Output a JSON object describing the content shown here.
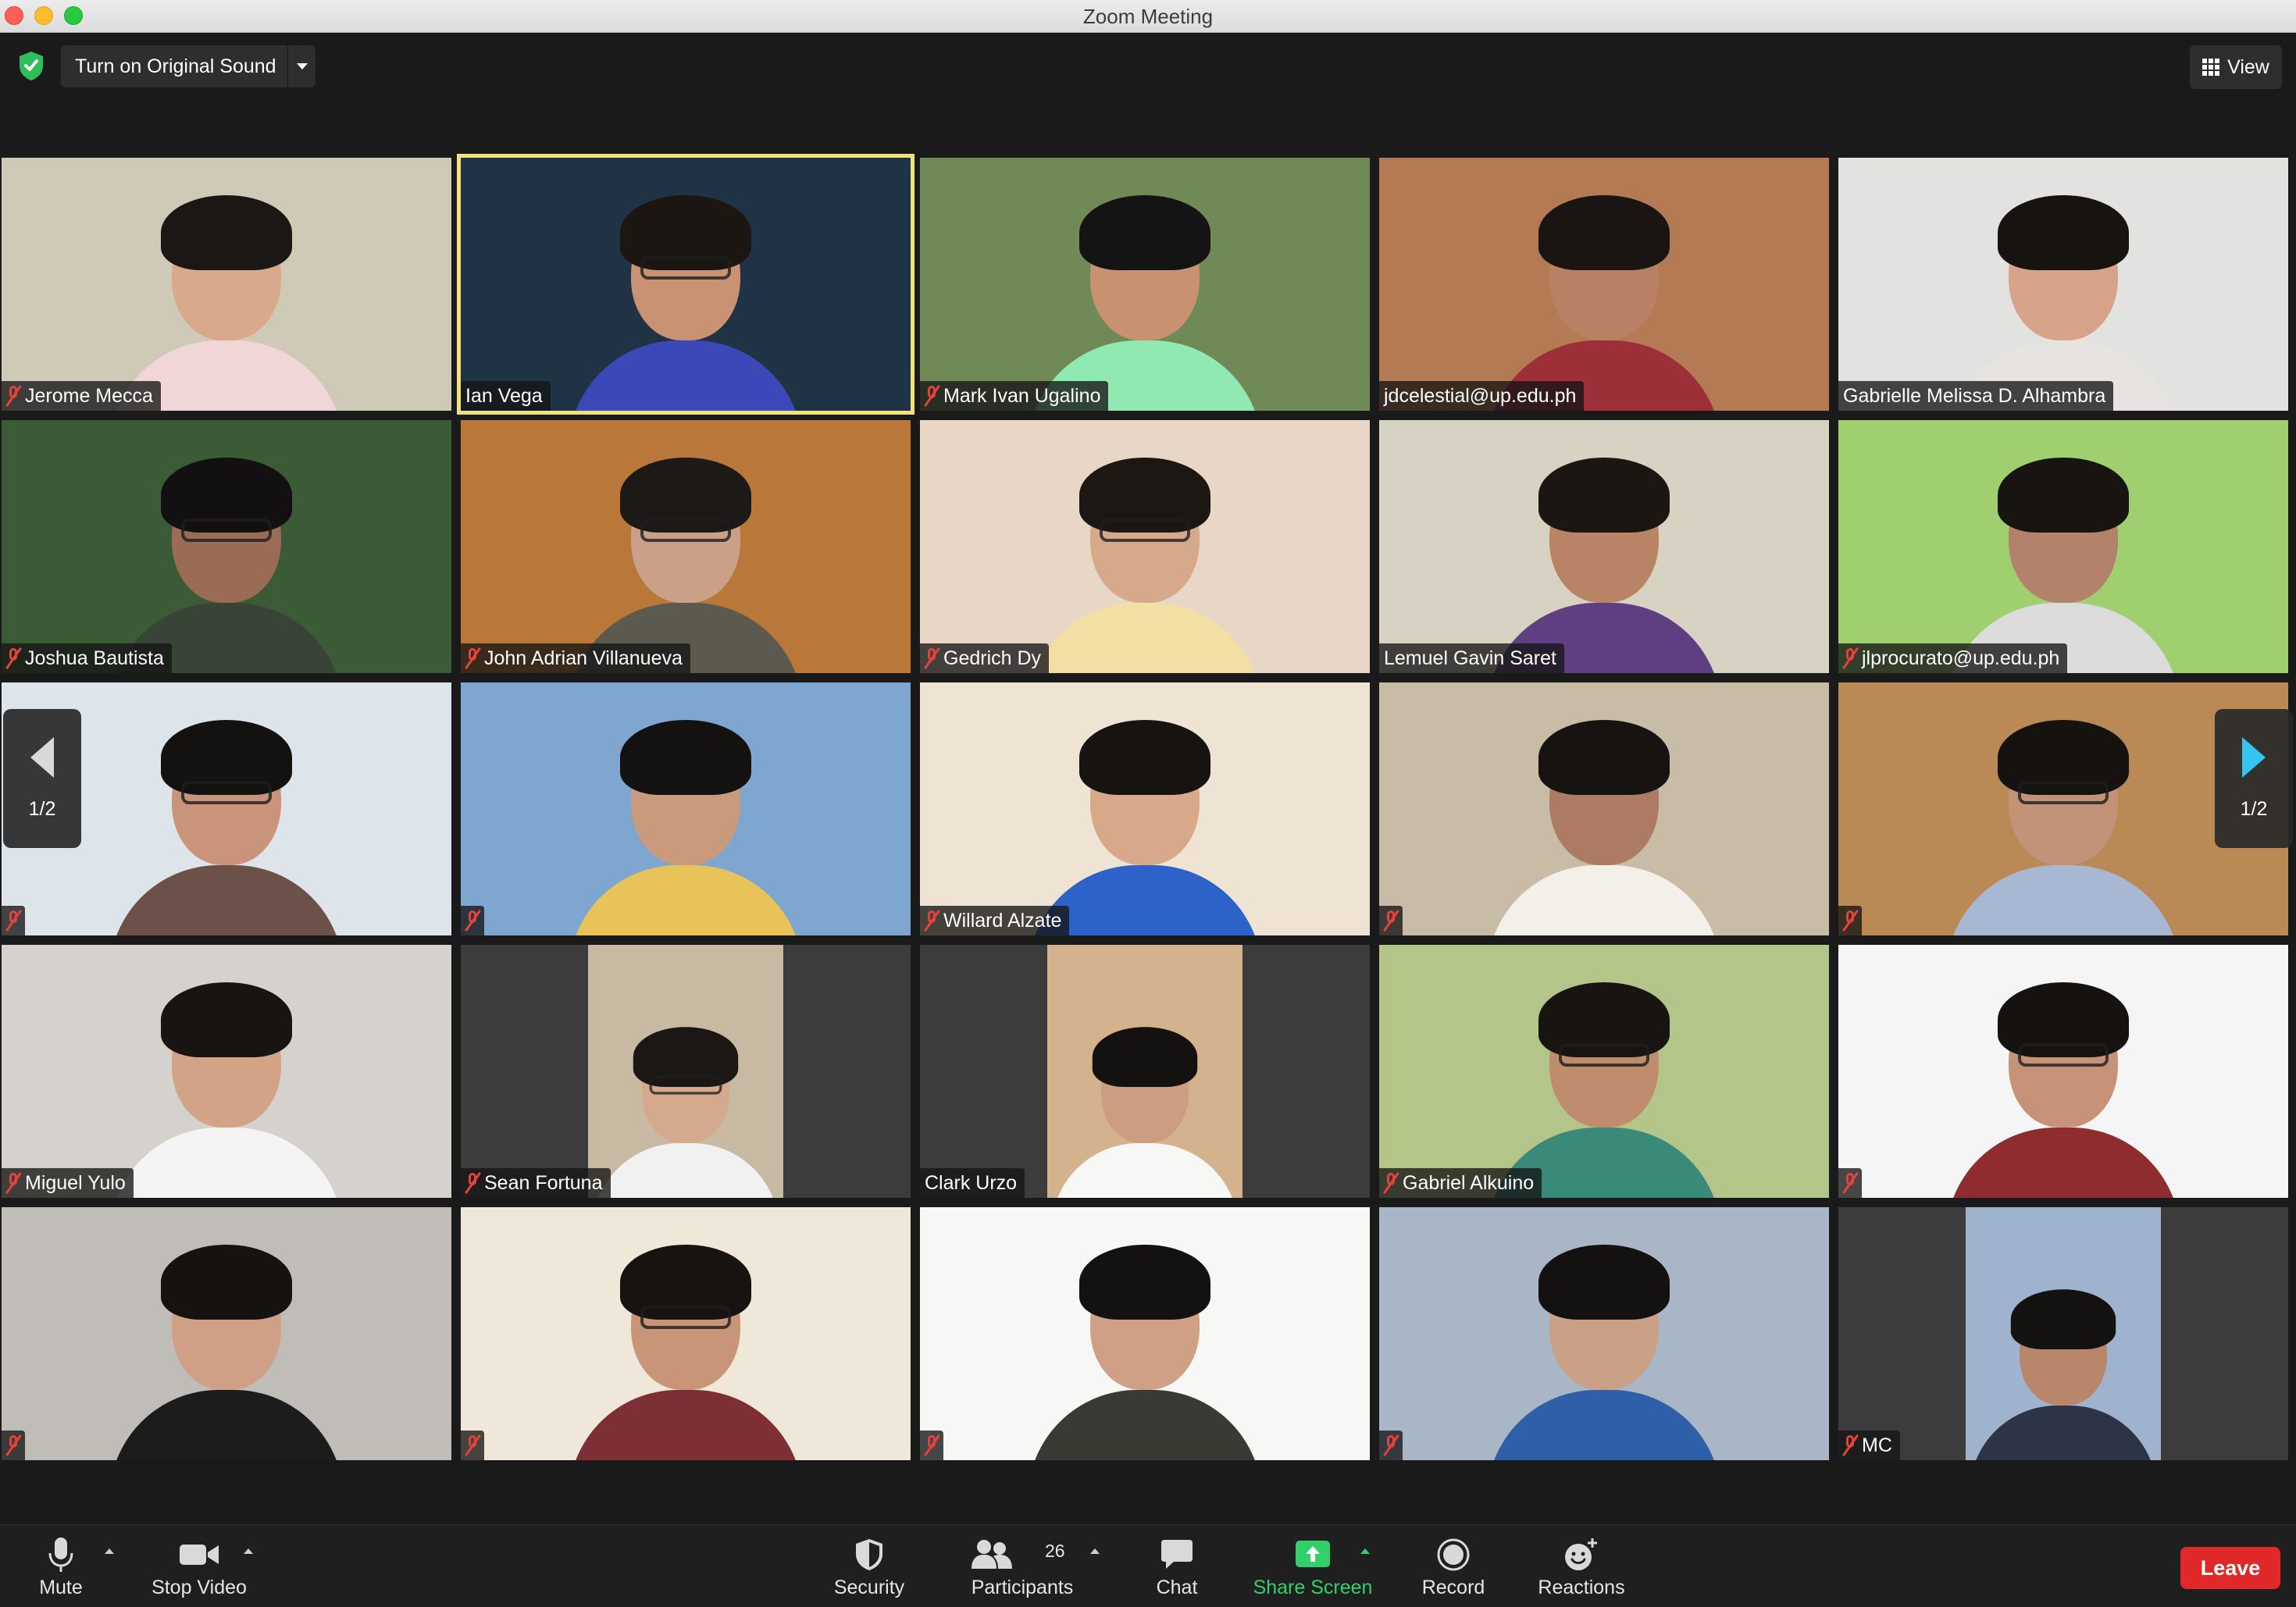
{
  "window": {
    "title": "Zoom Meeting"
  },
  "topbar": {
    "original_sound_label": "Turn on Original Sound",
    "view_label": "View"
  },
  "participants": [
    {
      "name": "Jerome Mecca",
      "muted": true,
      "active": false,
      "bg": "#cfcab8",
      "skin": "#d9a98b",
      "hair": "#1b1714",
      "shirt": "#f1d6d8",
      "glasses": false
    },
    {
      "name": "Ian Vega",
      "muted": false,
      "active": true,
      "bg": "#1f3344",
      "skin": "#c89273",
      "hair": "#1b1612",
      "shirt": "#3d48b8",
      "glasses": true
    },
    {
      "name": "Mark Ivan Ugalino",
      "muted": true,
      "active": false,
      "bg": "#6f8a57",
      "skin": "#c89170",
      "hair": "#141414",
      "shirt": "#8fe9b0",
      "glasses": false
    },
    {
      "name": "jdcelestial@up.edu.ph",
      "muted": false,
      "active": false,
      "bg": "#b37a54",
      "skin": "#b98163",
      "hair": "#1a1512",
      "shirt": "#9c2f37",
      "glasses": false
    },
    {
      "name": "Gabrielle Melissa D. Alhambra",
      "muted": false,
      "active": false,
      "bg": "#e2e2e0",
      "skin": "#d7a489",
      "hair": "#171311",
      "shirt": "#e7e3e0",
      "glasses": false
    },
    {
      "name": "Joshua Bautista",
      "muted": true,
      "active": false,
      "bg": "#3b5a36",
      "skin": "#9a6c55",
      "hair": "#121010",
      "shirt": "#384436",
      "glasses": true
    },
    {
      "name": "John Adrian Villanueva",
      "muted": true,
      "active": false,
      "bg": "#b9783a",
      "skin": "#caa088",
      "hair": "#1d1916",
      "shirt": "#5c5a4f",
      "glasses": true
    },
    {
      "name": "Gedrich Dy",
      "muted": true,
      "active": false,
      "bg": "#e8d7c7",
      "skin": "#d7a98b",
      "hair": "#1c1712",
      "shirt": "#f2dfa3",
      "glasses": true
    },
    {
      "name": "Lemuel Gavin Saret",
      "muted": false,
      "active": false,
      "bg": "#d8d2c3",
      "skin": "#b98466",
      "hair": "#1c1612",
      "shirt": "#5f3f82",
      "glasses": false
    },
    {
      "name": "jlprocurato@up.edu.ph",
      "muted": true,
      "active": false,
      "bg": "#9fcf6f",
      "skin": "#b3826a",
      "hair": "#181412",
      "shirt": "#dcdcdc",
      "glasses": false
    },
    {
      "name": "",
      "muted": true,
      "active": false,
      "bg": "#dde4ea",
      "skin": "#c99479",
      "hair": "#141210",
      "shirt": "#6b5148",
      "glasses": true
    },
    {
      "name": "",
      "muted": true,
      "active": false,
      "bg": "#7ea6cf",
      "skin": "#c99b7c",
      "hair": "#141210",
      "shirt": "#e8c35a",
      "glasses": false
    },
    {
      "name": "Willard Alzate",
      "muted": true,
      "active": false,
      "bg": "#efe3d3",
      "skin": "#d7a88a",
      "hair": "#161310",
      "shirt": "#2d62c9",
      "glasses": false
    },
    {
      "name": "",
      "muted": true,
      "active": false,
      "bg": "#c9bca7",
      "skin": "#ad7b63",
      "hair": "#171311",
      "shirt": "#f3f0ea",
      "glasses": false
    },
    {
      "name": "",
      "muted": true,
      "active": false,
      "bg": "#b98a55",
      "skin": "#c29377",
      "hair": "#151210",
      "shirt": "#a9b8d2",
      "glasses": true
    },
    {
      "name": "Miguel Yulo",
      "muted": true,
      "active": false,
      "bg": "#d5d1cc",
      "skin": "#d3a388",
      "hair": "#181412",
      "shirt": "#f4f4f4",
      "glasses": false
    },
    {
      "name": "Sean Fortuna",
      "muted": true,
      "active": false,
      "bg": "#3c3c3c",
      "skin": "#d5a98e",
      "hair": "#1b1714",
      "shirt": "#f1f1f1",
      "glasses": true,
      "inset": "#c8b9a3"
    },
    {
      "name": "Clark Urzo",
      "muted": false,
      "active": false,
      "bg": "#3c3c3c",
      "skin": "#cc9d80",
      "hair": "#141210",
      "shirt": "#f7f7f5",
      "glasses": false,
      "inset": "#d3b28d"
    },
    {
      "name": "Gabriel Alkuino",
      "muted": true,
      "active": false,
      "bg": "#b4c58a",
      "skin": "#bf8d6d",
      "hair": "#181412",
      "shirt": "#3a8a79",
      "glasses": true
    },
    {
      "name": "",
      "muted": true,
      "active": false,
      "bg": "#f5f5f5",
      "skin": "#c69378",
      "hair": "#151210",
      "shirt": "#8e2c2f",
      "glasses": true
    },
    {
      "name": "",
      "muted": true,
      "active": false,
      "bg": "#c0bdb8",
      "skin": "#d0a086",
      "hair": "#151210",
      "shirt": "#1c1c1c",
      "glasses": false
    },
    {
      "name": "",
      "muted": true,
      "active": false,
      "bg": "#efe8d8",
      "skin": "#c89579",
      "hair": "#171311",
      "shirt": "#7e2f35",
      "glasses": true
    },
    {
      "name": "",
      "muted": true,
      "active": false,
      "bg": "#f7f7f5",
      "skin": "#cfa085",
      "hair": "#141210",
      "shirt": "#3a3a34",
      "glasses": false
    },
    {
      "name": "",
      "muted": true,
      "active": false,
      "bg": "#a8b6c6",
      "skin": "#caa087",
      "hair": "#141210",
      "shirt": "#2f5fa8",
      "glasses": false
    },
    {
      "name": "MC",
      "muted": true,
      "active": false,
      "bg": "#3c3c3c",
      "skin": "#b8866b",
      "hair": "#141210",
      "shirt": "#2d3448",
      "glasses": false,
      "inset": "#9fb3cf"
    }
  ],
  "pagination": {
    "left_label": "1/2",
    "right_label": "1/2"
  },
  "toolbar": {
    "mute_label": "Mute",
    "stop_video_label": "Stop Video",
    "security_label": "Security",
    "participants_label": "Participants",
    "participants_count": "26",
    "chat_label": "Chat",
    "share_screen_label": "Share Screen",
    "record_label": "Record",
    "reactions_label": "Reactions",
    "leave_label": "Leave"
  },
  "colors": {
    "accent_green": "#31d06b",
    "leave_red": "#e02828",
    "active_speaker": "#f2e27a",
    "mute_red": "#e5423c"
  }
}
